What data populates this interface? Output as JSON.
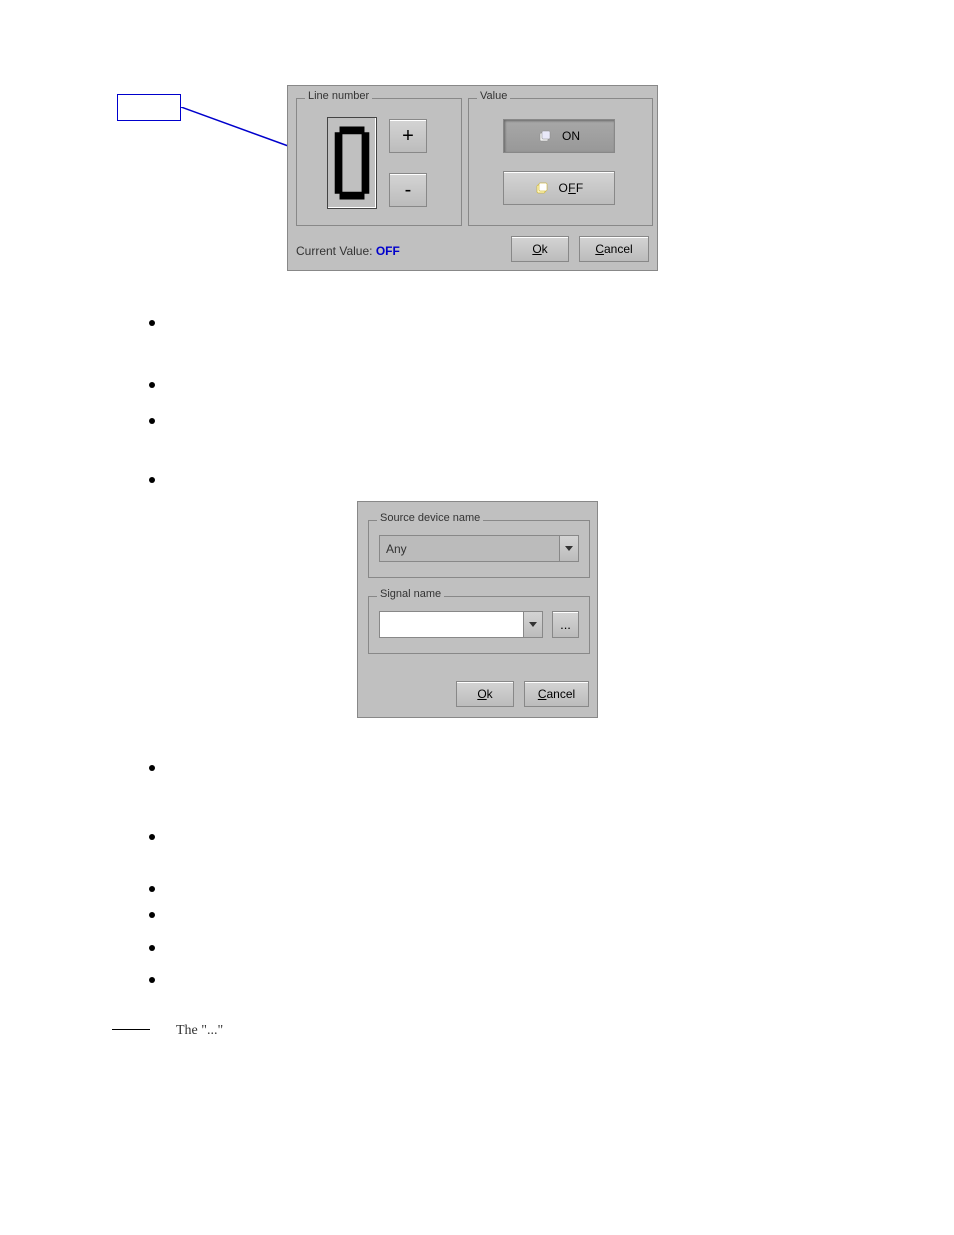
{
  "dialog1": {
    "lineNumberGroup": "Line number",
    "valueGroup": "Value",
    "plus": "+",
    "minus": "-",
    "on": "ON",
    "off": "OFF",
    "currentLabel": "Current Value: ",
    "currentValue": "OFF",
    "ok": "Ok",
    "cancel": "Cancel",
    "digit": "0"
  },
  "dialog2": {
    "sourceGroup": "Source device name",
    "signalGroup": "Signal name",
    "sourceValue": "Any",
    "signalValue": "",
    "browse": "...",
    "ok": "Ok",
    "cancel": "Cancel"
  },
  "lowerText": "The \"...\""
}
